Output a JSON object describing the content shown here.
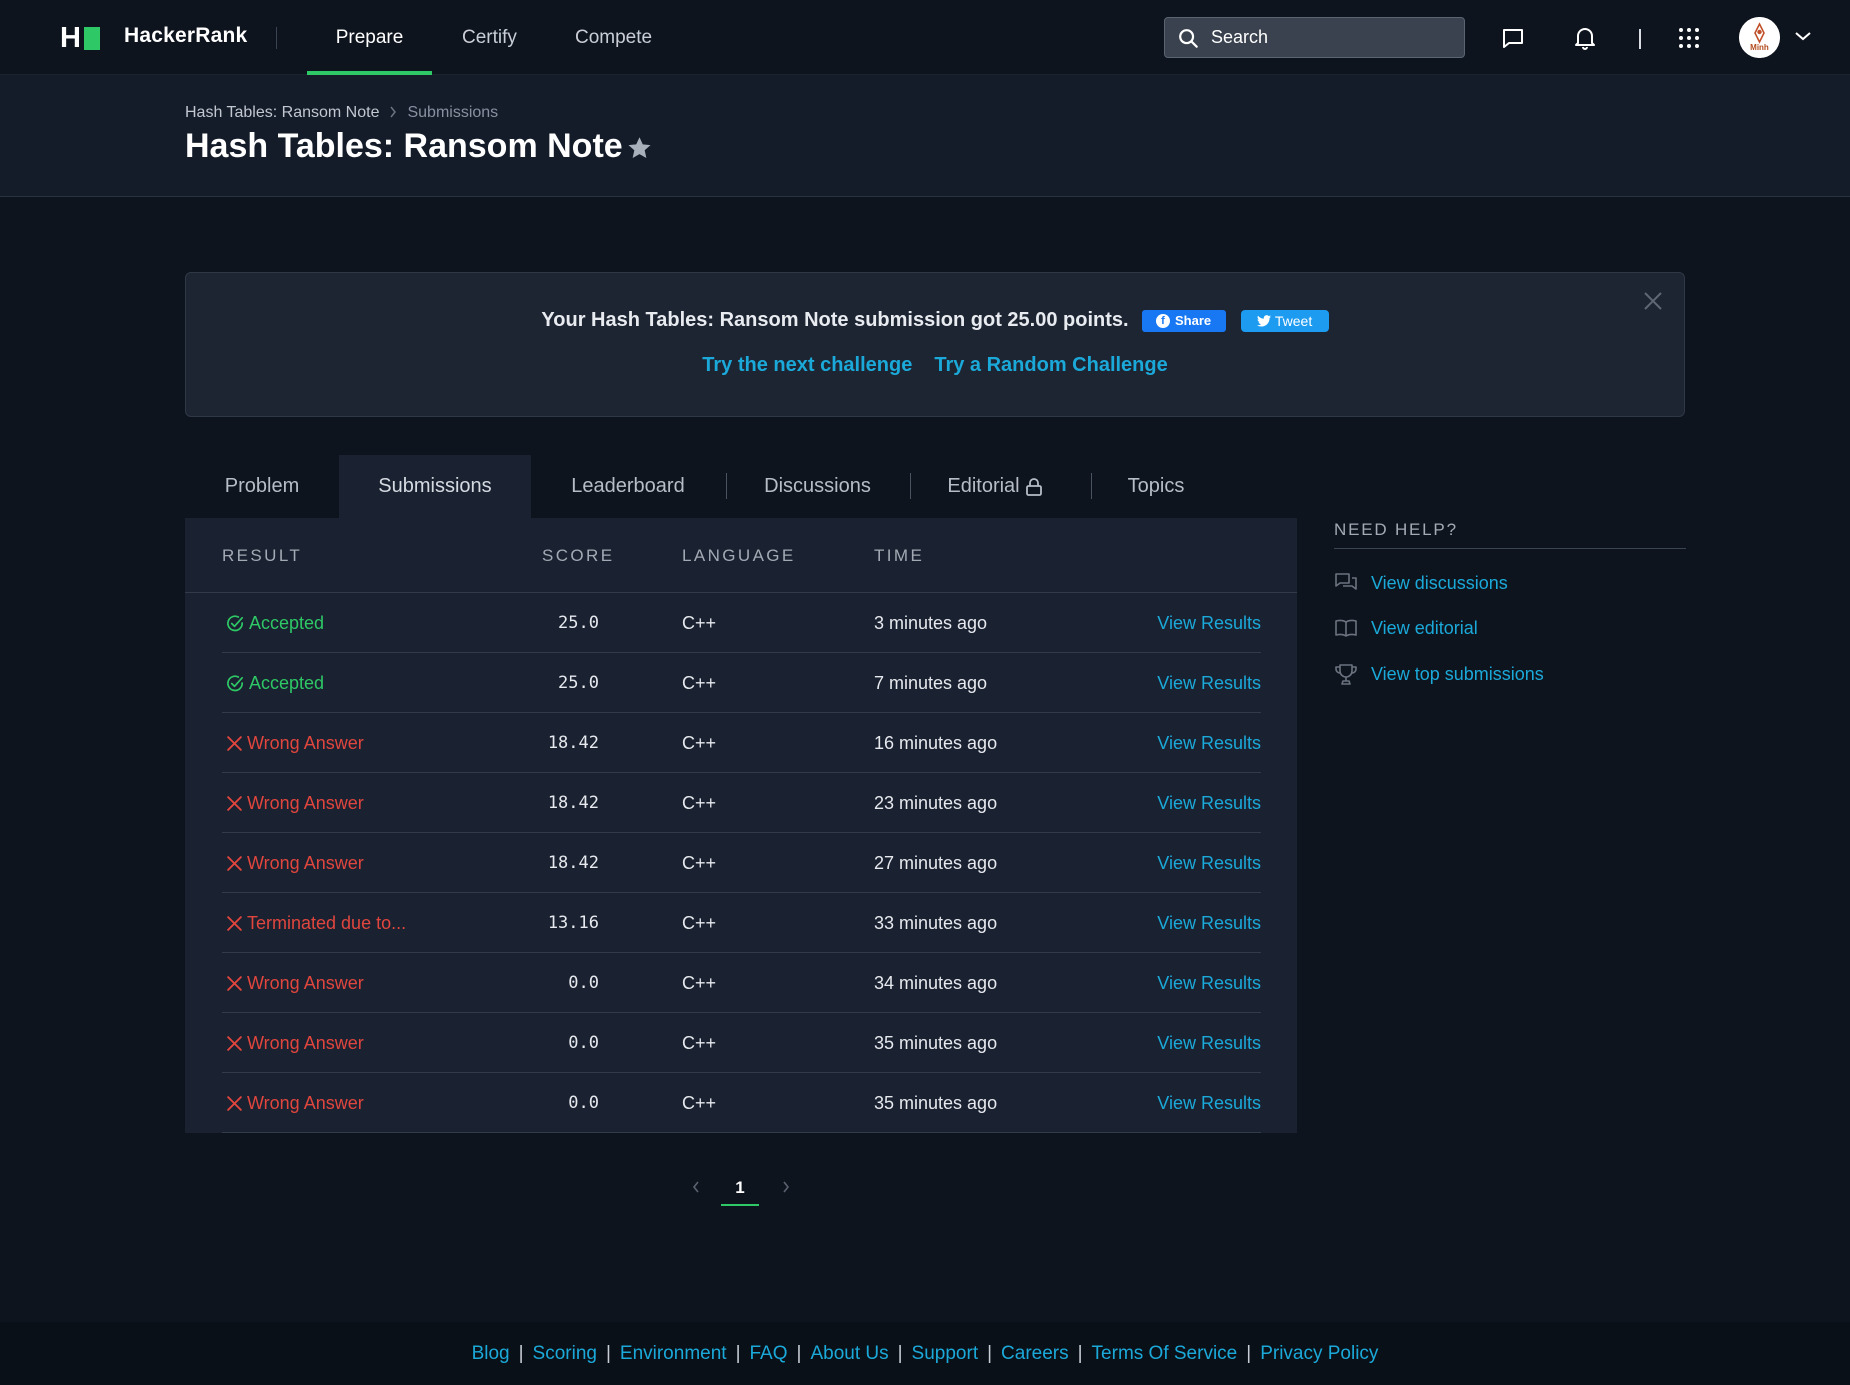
{
  "nav": {
    "logo_letter": "H",
    "brand": "HackerRank",
    "tabs": [
      {
        "label": "Prepare",
        "active": true
      },
      {
        "label": "Certify",
        "active": false
      },
      {
        "label": "Compete",
        "active": false
      }
    ],
    "search_placeholder": "Search",
    "avatar_text": "Minh"
  },
  "breadcrumb": {
    "parent": "Hash Tables: Ransom Note",
    "current": "Submissions"
  },
  "page_title": "Hash Tables: Ransom Note",
  "banner": {
    "message": "Your Hash Tables: Ransom Note submission got 25.00 points.",
    "share_label": "Share",
    "tweet_label": "Tweet",
    "next_challenge": "Try the next challenge",
    "random_challenge": "Try a Random Challenge"
  },
  "tabs": [
    {
      "label": "Problem",
      "active": false
    },
    {
      "label": "Submissions",
      "active": true
    },
    {
      "label": "Leaderboard",
      "active": false
    },
    {
      "label": "Discussions",
      "active": false
    },
    {
      "label": "Editorial",
      "active": false,
      "locked": true
    },
    {
      "label": "Topics",
      "active": false
    }
  ],
  "table": {
    "headers": {
      "result": "RESULT",
      "score": "SCORE",
      "language": "LANGUAGE",
      "time": "TIME"
    },
    "rows": [
      {
        "result": "Accepted",
        "status": "ok",
        "score": "25.0",
        "language": "C++",
        "time": "3 minutes ago",
        "action": "View Results"
      },
      {
        "result": "Accepted",
        "status": "ok",
        "score": "25.0",
        "language": "C++",
        "time": "7 minutes ago",
        "action": "View Results"
      },
      {
        "result": "Wrong Answer",
        "status": "bad",
        "score": "18.42",
        "language": "C++",
        "time": "16 minutes ago",
        "action": "View Results"
      },
      {
        "result": "Wrong Answer",
        "status": "bad",
        "score": "18.42",
        "language": "C++",
        "time": "23 minutes ago",
        "action": "View Results"
      },
      {
        "result": "Wrong Answer",
        "status": "bad",
        "score": "18.42",
        "language": "C++",
        "time": "27 minutes ago",
        "action": "View Results"
      },
      {
        "result": "Terminated due to...",
        "status": "bad",
        "score": "13.16",
        "language": "C++",
        "time": "33 minutes ago",
        "action": "View Results"
      },
      {
        "result": "Wrong Answer",
        "status": "bad",
        "score": "0.0",
        "language": "C++",
        "time": "34 minutes ago",
        "action": "View Results"
      },
      {
        "result": "Wrong Answer",
        "status": "bad",
        "score": "0.0",
        "language": "C++",
        "time": "35 minutes ago",
        "action": "View Results"
      },
      {
        "result": "Wrong Answer",
        "status": "bad",
        "score": "0.0",
        "language": "C++",
        "time": "35 minutes ago",
        "action": "View Results"
      }
    ]
  },
  "pagination": {
    "current": "1"
  },
  "help": {
    "title": "NEED HELP?",
    "items": [
      {
        "label": "View discussions",
        "icon": "discussions-icon"
      },
      {
        "label": "View editorial",
        "icon": "book-icon"
      },
      {
        "label": "View top submissions",
        "icon": "trophy-icon"
      }
    ]
  },
  "footer": {
    "links": [
      "Blog",
      "Scoring",
      "Environment",
      "FAQ",
      "About Us",
      "Support",
      "Careers",
      "Terms Of Service",
      "Privacy Policy"
    ]
  },
  "colors": {
    "accent_green": "#2ec866",
    "link_blue": "#1ba9d9",
    "error_red": "#e0463e",
    "background": "#0e141e"
  }
}
